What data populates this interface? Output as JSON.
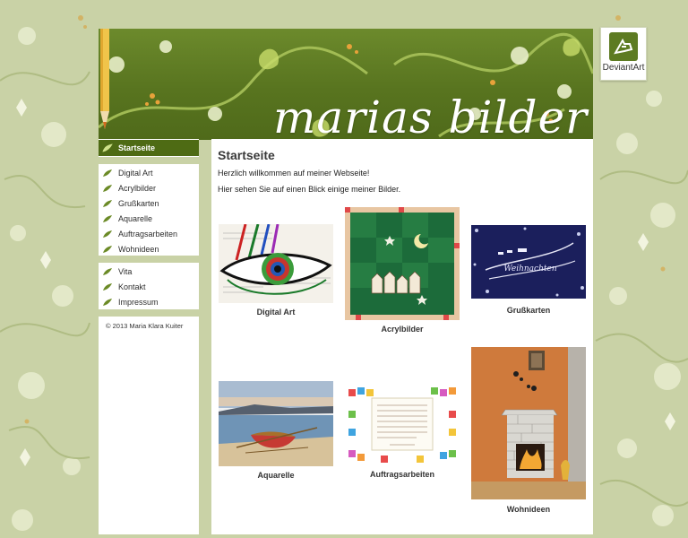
{
  "header": {
    "site_title": "marias  bilder",
    "deviantart_label": "DeviantArt"
  },
  "sidebar": {
    "active_item": "Startseite",
    "group1": [
      "Digital Art",
      "Acrylbilder",
      "Grußkarten",
      "Aquarelle",
      "Auftragsarbeiten",
      "Wohnideen"
    ],
    "group2": [
      "Vita",
      "Kontakt",
      "Impressum"
    ],
    "copyright": "© 2013 Maria Klara Kuiter"
  },
  "main": {
    "title": "Startseite",
    "intro_line1": "Herzlich willkommen auf meiner Webseite!",
    "intro_line2": "Hier sehen Sie auf einen Blick einige meiner Bilder.",
    "gallery": [
      {
        "caption": "Digital Art"
      },
      {
        "caption": "Acrylbilder"
      },
      {
        "caption": "Grußkarten"
      },
      {
        "caption": "Aquarelle"
      },
      {
        "caption": "Auftragsarbeiten"
      },
      {
        "caption": "Wohnideen"
      }
    ],
    "greeting_card_text": "Weihnachten"
  },
  "colors": {
    "accent": "#4e6b14",
    "background": "#c9d2a6",
    "banner": "#5b7820"
  }
}
